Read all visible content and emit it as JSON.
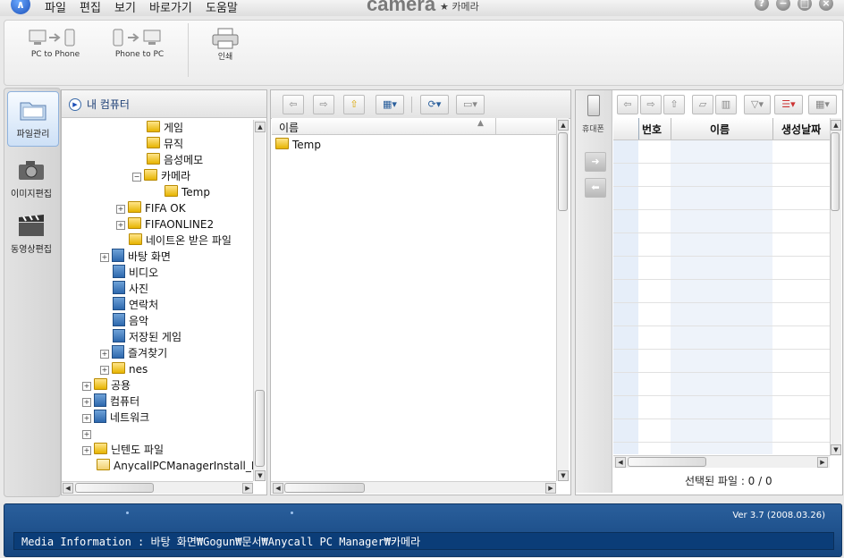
{
  "titlebar": {
    "logo_glyph": "∧",
    "menu": [
      "파일",
      "편집",
      "보기",
      "바로가기",
      "도움말"
    ],
    "brand": "camera",
    "brand_sub": "★ 카메라",
    "window_buttons": [
      "?",
      "−",
      "□",
      "×"
    ]
  },
  "toolbar": {
    "pc_to_phone": "PC to Phone",
    "phone_to_pc": "Phone to PC",
    "print": "인쇄"
  },
  "leftnav": {
    "file_mgmt": "파일관리",
    "image_edit": "이미지편집",
    "video_edit": "동영상편집"
  },
  "tree": {
    "header": "내 컴퓨터",
    "items": [
      {
        "label": "게임",
        "icon": "folder-icon"
      },
      {
        "label": "뮤직",
        "icon": "folder-icon"
      },
      {
        "label": "음성메모",
        "icon": "folder-icon"
      },
      {
        "label": "카메라",
        "icon": "folder-icon",
        "expander": "−"
      },
      {
        "label": "Temp",
        "icon": "folder-icon"
      },
      {
        "label": "FIFA OK",
        "icon": "folder-icon",
        "expander": "+"
      },
      {
        "label": "FIFAONLINE2",
        "icon": "folder-icon",
        "expander": "+"
      },
      {
        "label": "네이트온 받은 파일",
        "icon": "folder-icon"
      },
      {
        "label": "바탕 화면",
        "icon": "desktop-icon",
        "expander": "+"
      },
      {
        "label": "비디오",
        "icon": "video-folder-icon"
      },
      {
        "label": "사진",
        "icon": "pictures-folder-icon"
      },
      {
        "label": "연락처",
        "icon": "contacts-folder-icon"
      },
      {
        "label": "음악",
        "icon": "music-folder-icon"
      },
      {
        "label": "저장된 게임",
        "icon": "saved-games-icon"
      },
      {
        "label": "즐겨찾기",
        "icon": "favorites-icon",
        "expander": "+"
      },
      {
        "label": "nes",
        "icon": "folder-icon",
        "expander": "+"
      },
      {
        "label": "공용",
        "icon": "folder-icon",
        "expander": "+"
      },
      {
        "label": "컴퓨터",
        "icon": "computer-icon",
        "expander": "+"
      },
      {
        "label": "네트워크",
        "icon": "network-icon",
        "expander": "+"
      },
      {
        "label": "",
        "icon": "",
        "expander": "+"
      },
      {
        "label": "닌텐도 파일",
        "icon": "folder-icon",
        "expander": "+"
      },
      {
        "label": "AnycallPCManagerInstall_Full",
        "icon": "file-icon"
      }
    ]
  },
  "filelist": {
    "column_name": "이름",
    "sort_glyph": "▲",
    "rows": [
      "Temp"
    ]
  },
  "phone": {
    "side_label": "휴대폰",
    "columns": [
      "번호",
      "이름",
      "생성날짜"
    ],
    "selected_files": "선택된 파일 : 0 / 0"
  },
  "statusbar": {
    "version": "Ver 3.7 (2008.03.26)",
    "media_info": "Media Information : 바탕 화면₩Gogun₩문서₩Anycall PC Manager₩카메라"
  }
}
